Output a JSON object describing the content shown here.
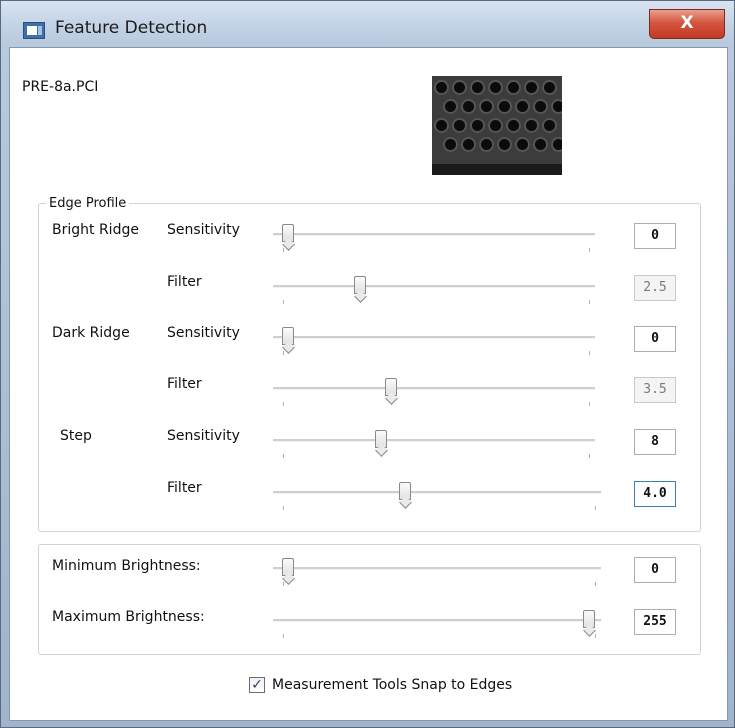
{
  "window": {
    "title": "Feature Detection",
    "close_symbol": "X"
  },
  "file": {
    "name": "PRE-8a.PCI"
  },
  "edge_profile": {
    "title": "Edge Profile",
    "sensitivity_label": "Sensitivity",
    "filter_label": "Filter",
    "groups": [
      {
        "name": "Bright Ridge",
        "sensitivity": {
          "value": "0",
          "position": 0.03
        },
        "filter": {
          "value": "2.5",
          "position": 0.26,
          "enabled": false
        }
      },
      {
        "name": "Dark Ridge",
        "sensitivity": {
          "value": "0",
          "position": 0.03
        },
        "filter": {
          "value": "3.5",
          "position": 0.36,
          "enabled": false
        }
      },
      {
        "name": "Step",
        "sensitivity": {
          "value": "8",
          "position": 0.33
        },
        "filter": {
          "value": "4.0",
          "position": 0.4,
          "enabled": true
        }
      }
    ]
  },
  "brightness": {
    "min": {
      "label": "Minimum Brightness:",
      "value": "0",
      "position": 0.03
    },
    "max": {
      "label": "Maximum Brightness:",
      "value": "255",
      "position": 0.98
    }
  },
  "snap": {
    "label": "Measurement Tools Snap to Edges",
    "checked": true,
    "check_glyph": "✓"
  },
  "colors": {
    "title_bar": "#c4d3e6",
    "close_button": "#c9402a",
    "frame": "#a8bcd3"
  }
}
